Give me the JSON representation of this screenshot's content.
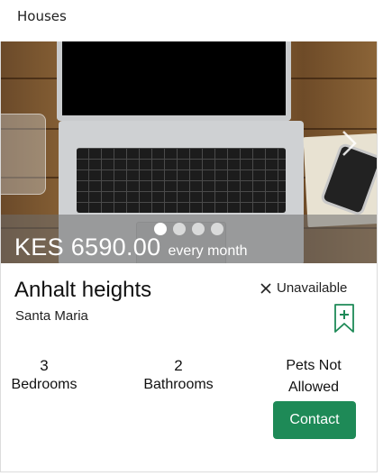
{
  "section": {
    "title": "Houses"
  },
  "listing": {
    "price_amount": "KES 6590.00",
    "price_period": "every month",
    "name": "Anhalt heights",
    "location": "Santa Maria",
    "availability": "Unavailable",
    "bedrooms": {
      "value": "3",
      "label": "Bedrooms"
    },
    "bathrooms": {
      "value": "2",
      "label": "Bathrooms"
    },
    "pets": "Pets Not Allowed",
    "contact_label": "Contact"
  },
  "carousel": {
    "slides": 4,
    "active_index": 0
  },
  "icons": {
    "availability": "close-icon",
    "bookmark": "bookmark-add-icon",
    "next": "chevron-right-icon"
  },
  "colors": {
    "accent": "#1e8a57",
    "bookmark": "#1e8a57"
  }
}
